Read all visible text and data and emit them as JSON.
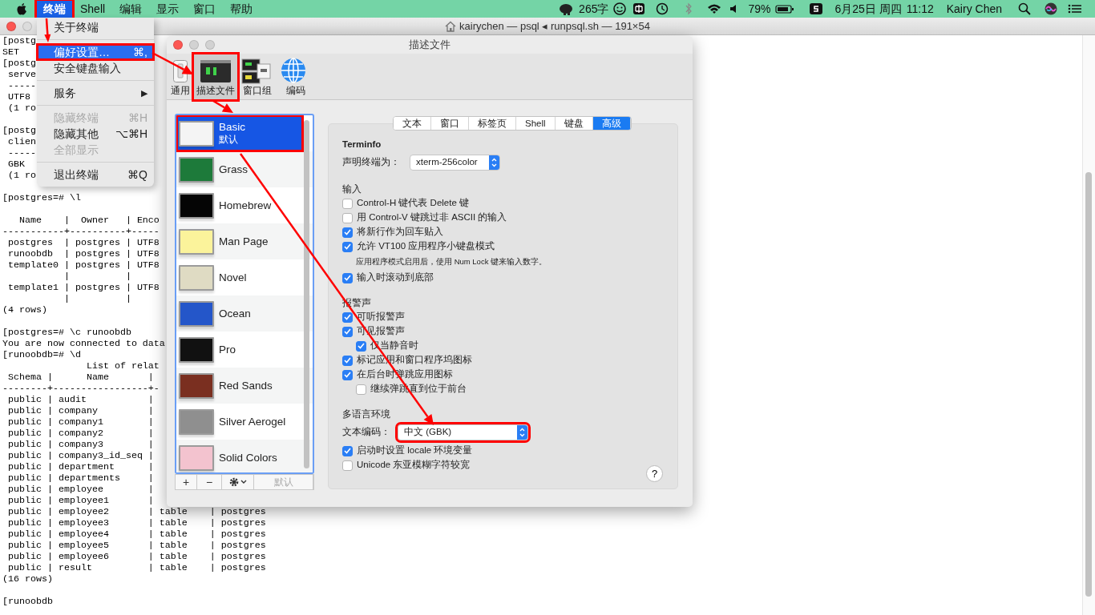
{
  "menu_bar": {
    "app_menus": [
      {
        "label": "终端",
        "selected": true,
        "highlighted": true
      },
      {
        "label": "Shell",
        "selected": false,
        "highlighted": false
      },
      {
        "label": "编辑",
        "selected": false,
        "highlighted": false
      },
      {
        "label": "显示",
        "selected": false,
        "highlighted": false
      },
      {
        "label": "窗口",
        "selected": false,
        "highlighted": false
      },
      {
        "label": "帮助",
        "selected": false,
        "highlighted": false
      }
    ],
    "status_texts": [
      "265字",
      "79%",
      "6月25日 周四",
      "11:12",
      "Kairy Chen"
    ]
  },
  "terminal": {
    "title": "kairychen — psql ◂ runpsql.sh — 191×54",
    "blocks": [
      [
        "[postg",
        "SET",
        "[postg",
        " serve",
        " -----",
        " UTF8",
        " (1 ro"
      ],
      [
        "[postg",
        " clien",
        " -----",
        " GBK",
        " (1 ro"
      ],
      [
        "[postgres=# \\l"
      ],
      [
        "   Name    |  Owner   | Enco",
        "-----------+----------+-----",
        " postgres  | postgres | UTF8",
        " runoobdb  | postgres | UTF8",
        " template0 | postgres | UTF8",
        "           |          |",
        " template1 | postgres | UTF8",
        "           |          |",
        "(4 rows)"
      ],
      [
        "[postgres=# \\c runoobdb",
        "You are now connected to data",
        "[runoobdb=# \\d",
        "               List of relat",
        " Schema |      Name       |",
        "--------+-----------------+-",
        " public | audit           |",
        " public | company         |",
        " public | company1        |",
        " public | company2        |",
        " public | company3        |",
        " public | company3_id_seq |",
        " public | department      |",
        " public | departments     |",
        " public | employee        |",
        " public | employee1       |",
        " public | employee2       | table    | postgres",
        " public | employee3       | table    | postgres",
        " public | employee4       | table    | postgres",
        " public | employee5       | table    | postgres",
        " public | employee6       | table    | postgres",
        " public | result          | table    | postgres",
        "(16 rows)"
      ],
      [
        "[runoobdb"
      ]
    ]
  },
  "app_menu": {
    "items": [
      {
        "kind": "item",
        "label": "关于终端",
        "disabled": false,
        "selected": false,
        "highlighted": false
      },
      {
        "kind": "separator"
      },
      {
        "kind": "item",
        "label": "偏好设置…",
        "shortcut": "⌘,",
        "disabled": false,
        "selected": true,
        "highlighted": true
      },
      {
        "kind": "item",
        "label": "安全键盘输入",
        "disabled": false,
        "selected": false,
        "highlighted": false
      },
      {
        "kind": "separator"
      },
      {
        "kind": "submenu",
        "label": "服务",
        "shortcut": "▶",
        "disabled": false,
        "selected": false,
        "highlighted": false
      },
      {
        "kind": "separator"
      },
      {
        "kind": "item",
        "label": "隐藏终端",
        "shortcut": "⌘H",
        "disabled": true,
        "selected": false,
        "highlighted": false
      },
      {
        "kind": "item",
        "label": "隐藏其他",
        "shortcut": "⌥⌘H",
        "disabled": false,
        "selected": false,
        "highlighted": false
      },
      {
        "kind": "item",
        "label": "全部显示",
        "disabled": true,
        "selected": false,
        "highlighted": false
      },
      {
        "kind": "separator"
      },
      {
        "kind": "item",
        "label": "退出终端",
        "shortcut": "⌘Q",
        "disabled": false,
        "selected": false,
        "highlighted": false
      }
    ]
  },
  "preferences": {
    "title": "描述文件",
    "toolbar": [
      {
        "kind": "general",
        "label": "通用",
        "selected": false,
        "highlighted": false
      },
      {
        "kind": "profiles",
        "label": "描述文件",
        "selected": true,
        "highlighted": true
      },
      {
        "kind": "groups",
        "label": "窗口组",
        "selected": false,
        "highlighted": false
      },
      {
        "kind": "encoding",
        "label": "编码",
        "selected": false,
        "highlighted": false
      }
    ],
    "profiles": [
      {
        "name": "Basic",
        "subtitle": "默认",
        "color": "#f4f4f4",
        "selected": true,
        "highlighted": true
      },
      {
        "name": "Grass",
        "color": "#1d7a3a",
        "selected": false,
        "highlighted": false
      },
      {
        "name": "Homebrew",
        "color": "#050505",
        "selected": false,
        "highlighted": false
      },
      {
        "name": "Man Page",
        "color": "#fbf39b",
        "selected": false,
        "highlighted": false
      },
      {
        "name": "Novel",
        "color": "#dfdbc3",
        "selected": false,
        "highlighted": false
      },
      {
        "name": "Ocean",
        "color": "#2456c9",
        "selected": false,
        "highlighted": false
      },
      {
        "name": "Pro",
        "color": "#111111",
        "selected": false,
        "highlighted": false
      },
      {
        "name": "Red Sands",
        "color": "#7a2f20",
        "selected": false,
        "highlighted": false
      },
      {
        "name": "Silver Aerogel",
        "color": "#8f8f8f",
        "selected": false,
        "highlighted": false
      },
      {
        "name": "Solid Colors",
        "color": "#f3c3cf",
        "selected": false,
        "highlighted": false
      }
    ],
    "list_buttons": [
      {
        "kind": "text",
        "label": "+",
        "disabled": false
      },
      {
        "kind": "text",
        "label": "−",
        "disabled": false
      },
      {
        "kind": "gear"
      },
      {
        "kind": "text",
        "label": "默认",
        "disabled": true
      }
    ],
    "tabs": [
      {
        "label": "文本",
        "selected": false
      },
      {
        "label": "窗口",
        "selected": false
      },
      {
        "label": "标签页",
        "selected": false
      },
      {
        "label": "Shell",
        "selected": false
      },
      {
        "label": "键盘",
        "selected": false
      },
      {
        "label": "高级",
        "selected": true
      }
    ],
    "sections": [
      {
        "title": "Terminfo",
        "items": [
          {
            "kind": "select",
            "label": "声明终端为：",
            "value": "xterm-256color",
            "highlighted": false
          }
        ]
      },
      {
        "title": "输入",
        "items": [
          {
            "kind": "checkbox",
            "label": "Control-H 键代表 Delete 键",
            "checked": false
          },
          {
            "kind": "checkbox",
            "label": "用 Control-V 键跳过非 ASCII 的输入",
            "checked": false
          },
          {
            "kind": "checkbox",
            "label": "将新行作为回车贴入",
            "checked": true
          },
          {
            "kind": "checkbox",
            "label": "允许 VT100 应用程序小键盘模式",
            "checked": true
          },
          {
            "kind": "note",
            "label": "应用程序模式启用后，使用 Num Lock 键来输入数字。"
          },
          {
            "kind": "checkbox",
            "label": "输入时滚动到底部",
            "checked": true
          }
        ]
      },
      {
        "title": "报警声",
        "items": [
          {
            "kind": "checkbox",
            "label": "可听报警声",
            "checked": true
          },
          {
            "kind": "checkbox",
            "label": "可见报警声",
            "checked": true,
            "children": [
              {
                "kind": "checkbox",
                "label": "仅当静音时",
                "checked": true
              }
            ]
          },
          {
            "kind": "checkbox",
            "label": "标记应用和窗口程序坞图标",
            "checked": true
          },
          {
            "kind": "checkbox",
            "label": "在后台时弹跳应用图标",
            "checked": true,
            "children": [
              {
                "kind": "checkbox",
                "label": "继续弹跳直到位于前台",
                "checked": false
              }
            ]
          }
        ]
      },
      {
        "title": "多语言环境",
        "items": [
          {
            "kind": "select",
            "label": "文本编码：",
            "value": "中文 (GBK)",
            "highlighted": true
          },
          {
            "kind": "checkbox",
            "label": "启动时设置 locale 环境变量",
            "checked": true
          },
          {
            "kind": "checkbox",
            "label": "Unicode 东亚模糊字符较宽",
            "checked": false
          }
        ]
      }
    ],
    "help": "?"
  }
}
